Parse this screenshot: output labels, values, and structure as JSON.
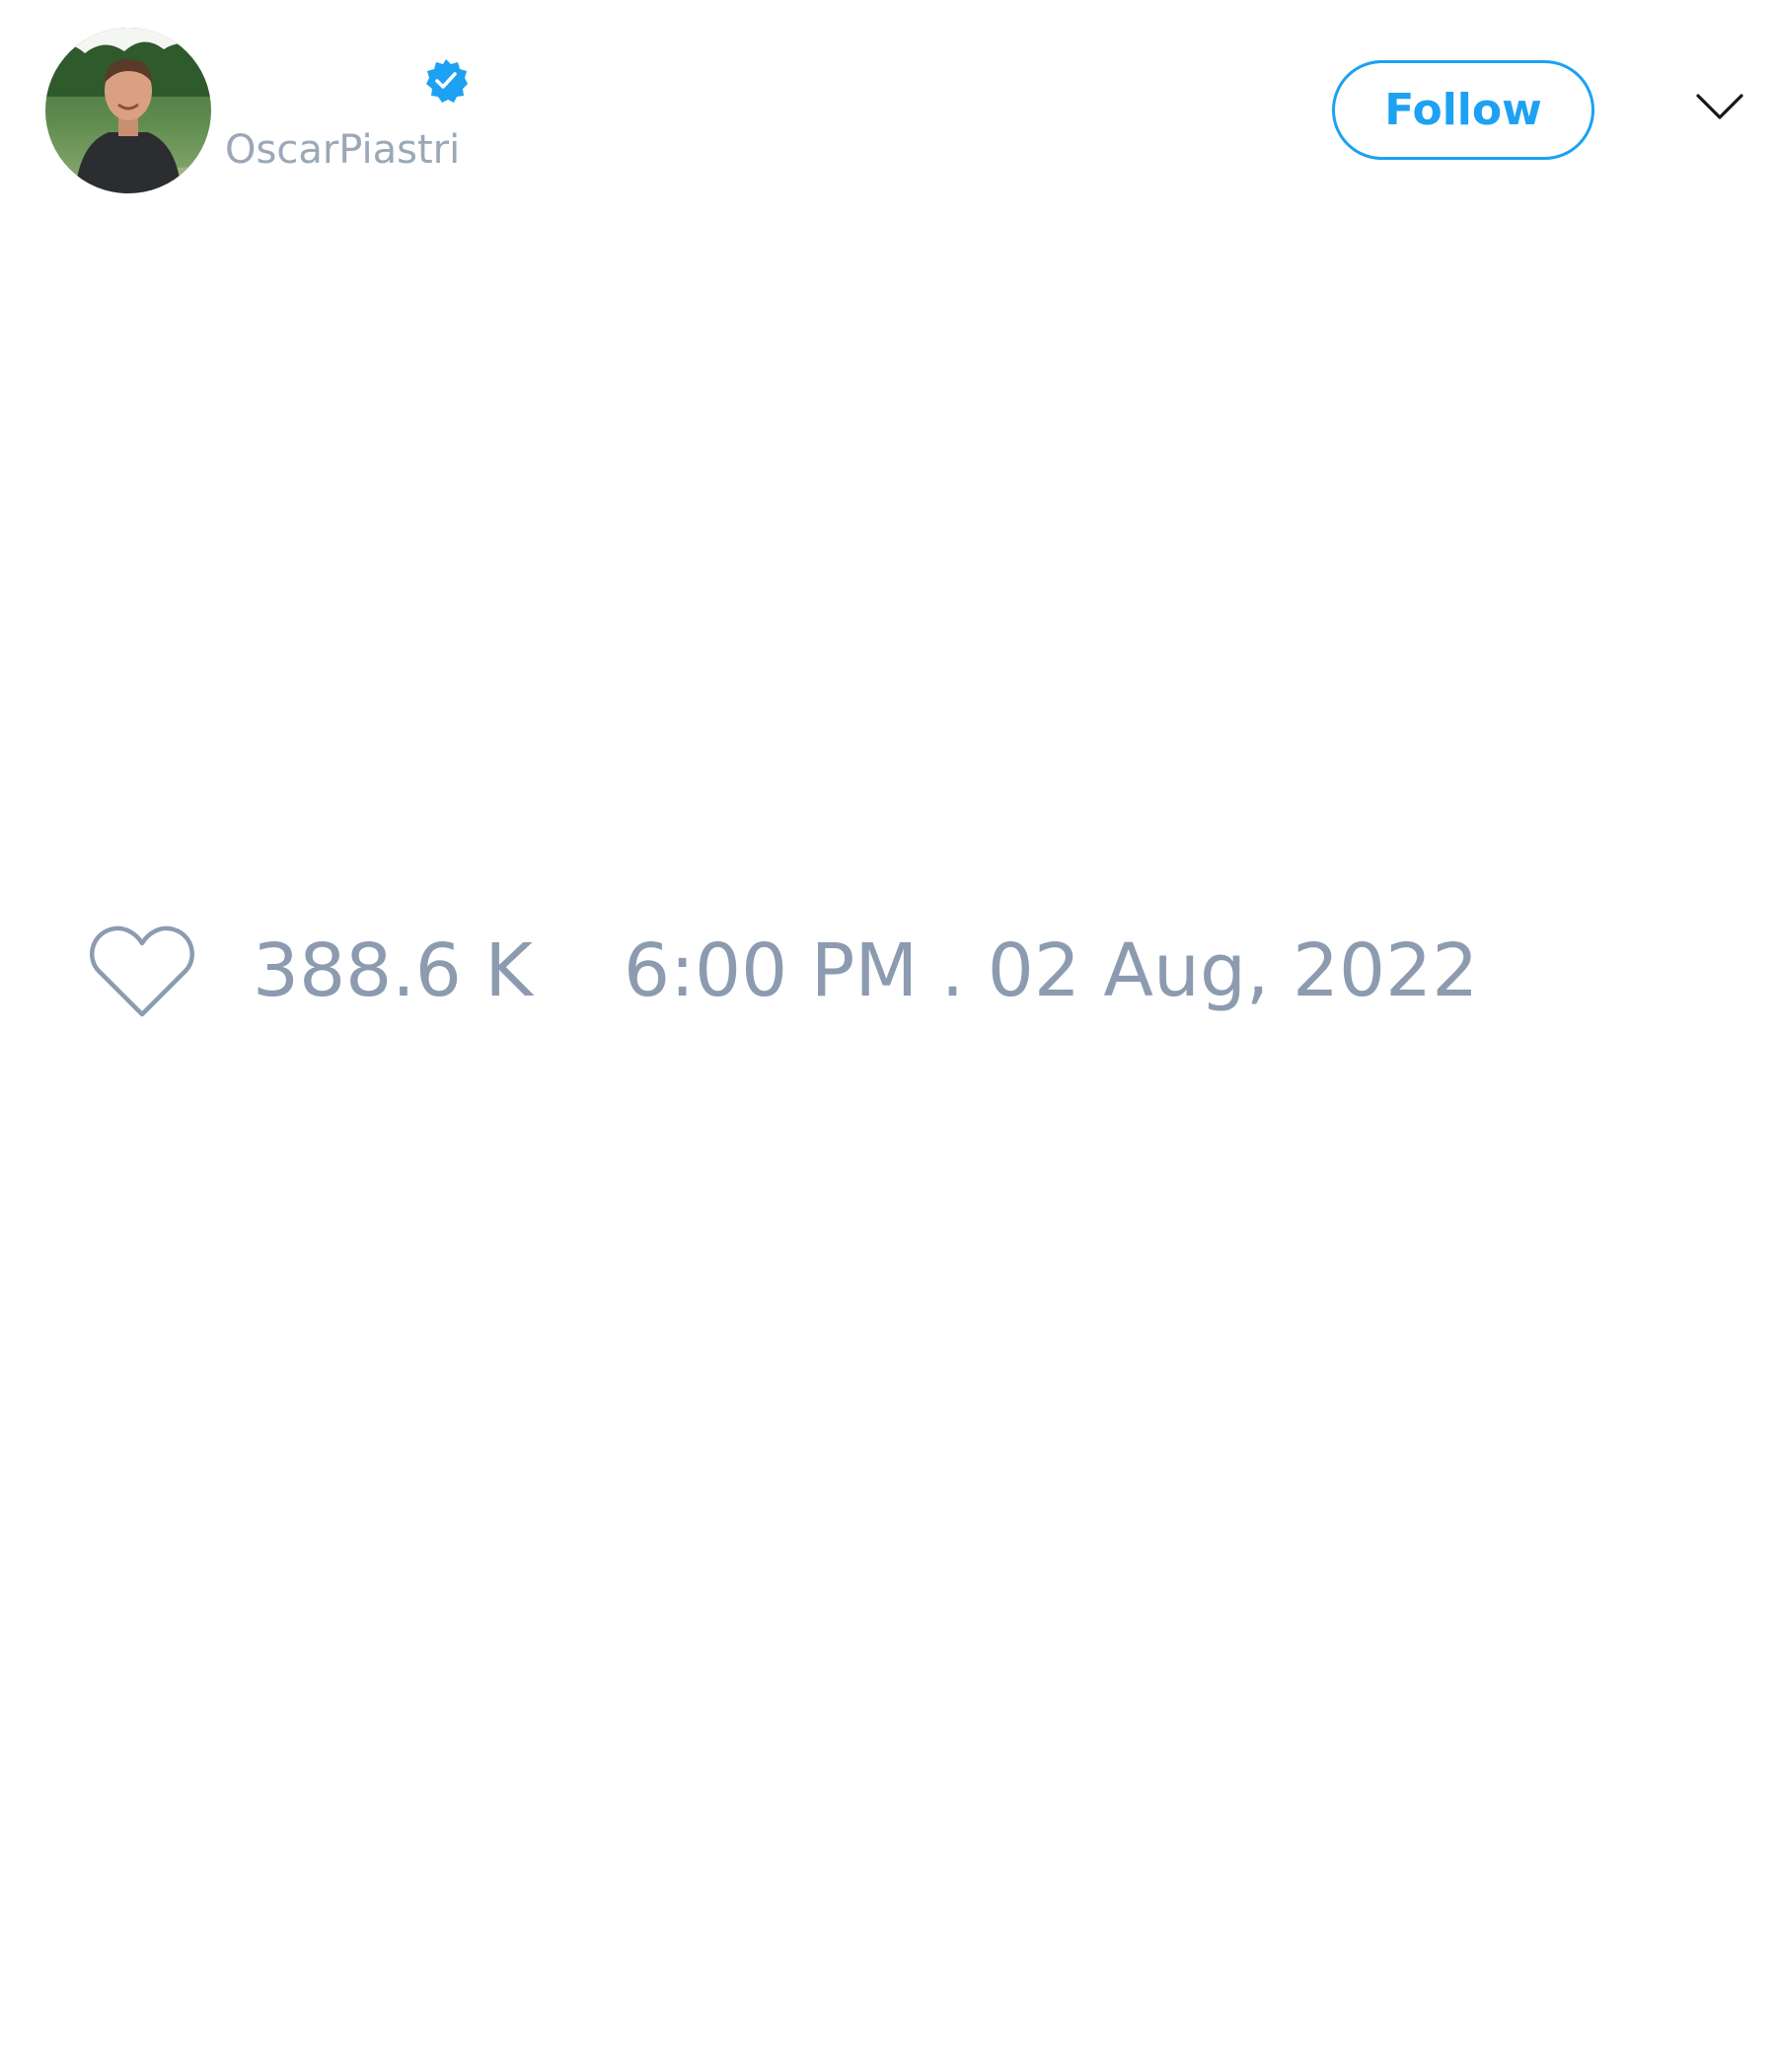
{
  "tweet": {
    "author": {
      "display_name": "",
      "handle": "OscarPiastri",
      "verified": true,
      "avatar_icon": "profile-photo"
    },
    "follow_label": "Follow",
    "menu_icon": "chevron-down-icon",
    "like_icon": "heart-outline-icon",
    "like_count": "388.6 K",
    "timestamp": "6:00 PM . 02 Aug, 2022"
  },
  "colors": {
    "accent": "#1da1f2",
    "muted_text": "#8c9bb0",
    "handle_text": "#9aa8b8",
    "icon_stroke": "#8c9bb0",
    "background": "#ffffff"
  }
}
